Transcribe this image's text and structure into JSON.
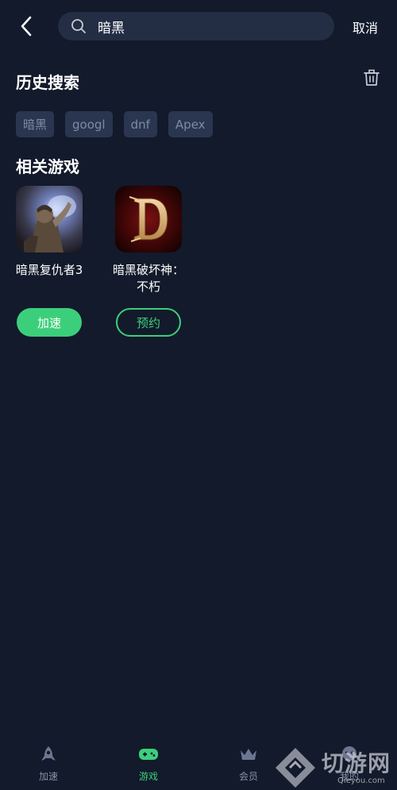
{
  "header": {
    "search_value": "暗黑",
    "cancel_label": "取消"
  },
  "history": {
    "title": "历史搜索",
    "items": [
      "暗黑",
      "googl",
      "dnf",
      "Apex"
    ]
  },
  "related": {
    "title": "相关游戏",
    "games": [
      {
        "name": "暗黑复仇者3",
        "button": "加速"
      },
      {
        "name": "暗黑破坏神：不朽",
        "button": "预约"
      }
    ]
  },
  "nav": {
    "items": [
      {
        "label": "加速",
        "icon": "rocket-icon"
      },
      {
        "label": "游戏",
        "icon": "gamepad-icon"
      },
      {
        "label": "会员",
        "icon": "crown-icon"
      },
      {
        "label": "我的",
        "icon": "profile-icon"
      }
    ]
  },
  "watermark": {
    "text": "切游网",
    "sub": "Qieyou.com"
  },
  "colors": {
    "background": "#121a2b",
    "accent": "#3ccf7b",
    "chip": "#2a3550",
    "search_box": "#232d44"
  }
}
